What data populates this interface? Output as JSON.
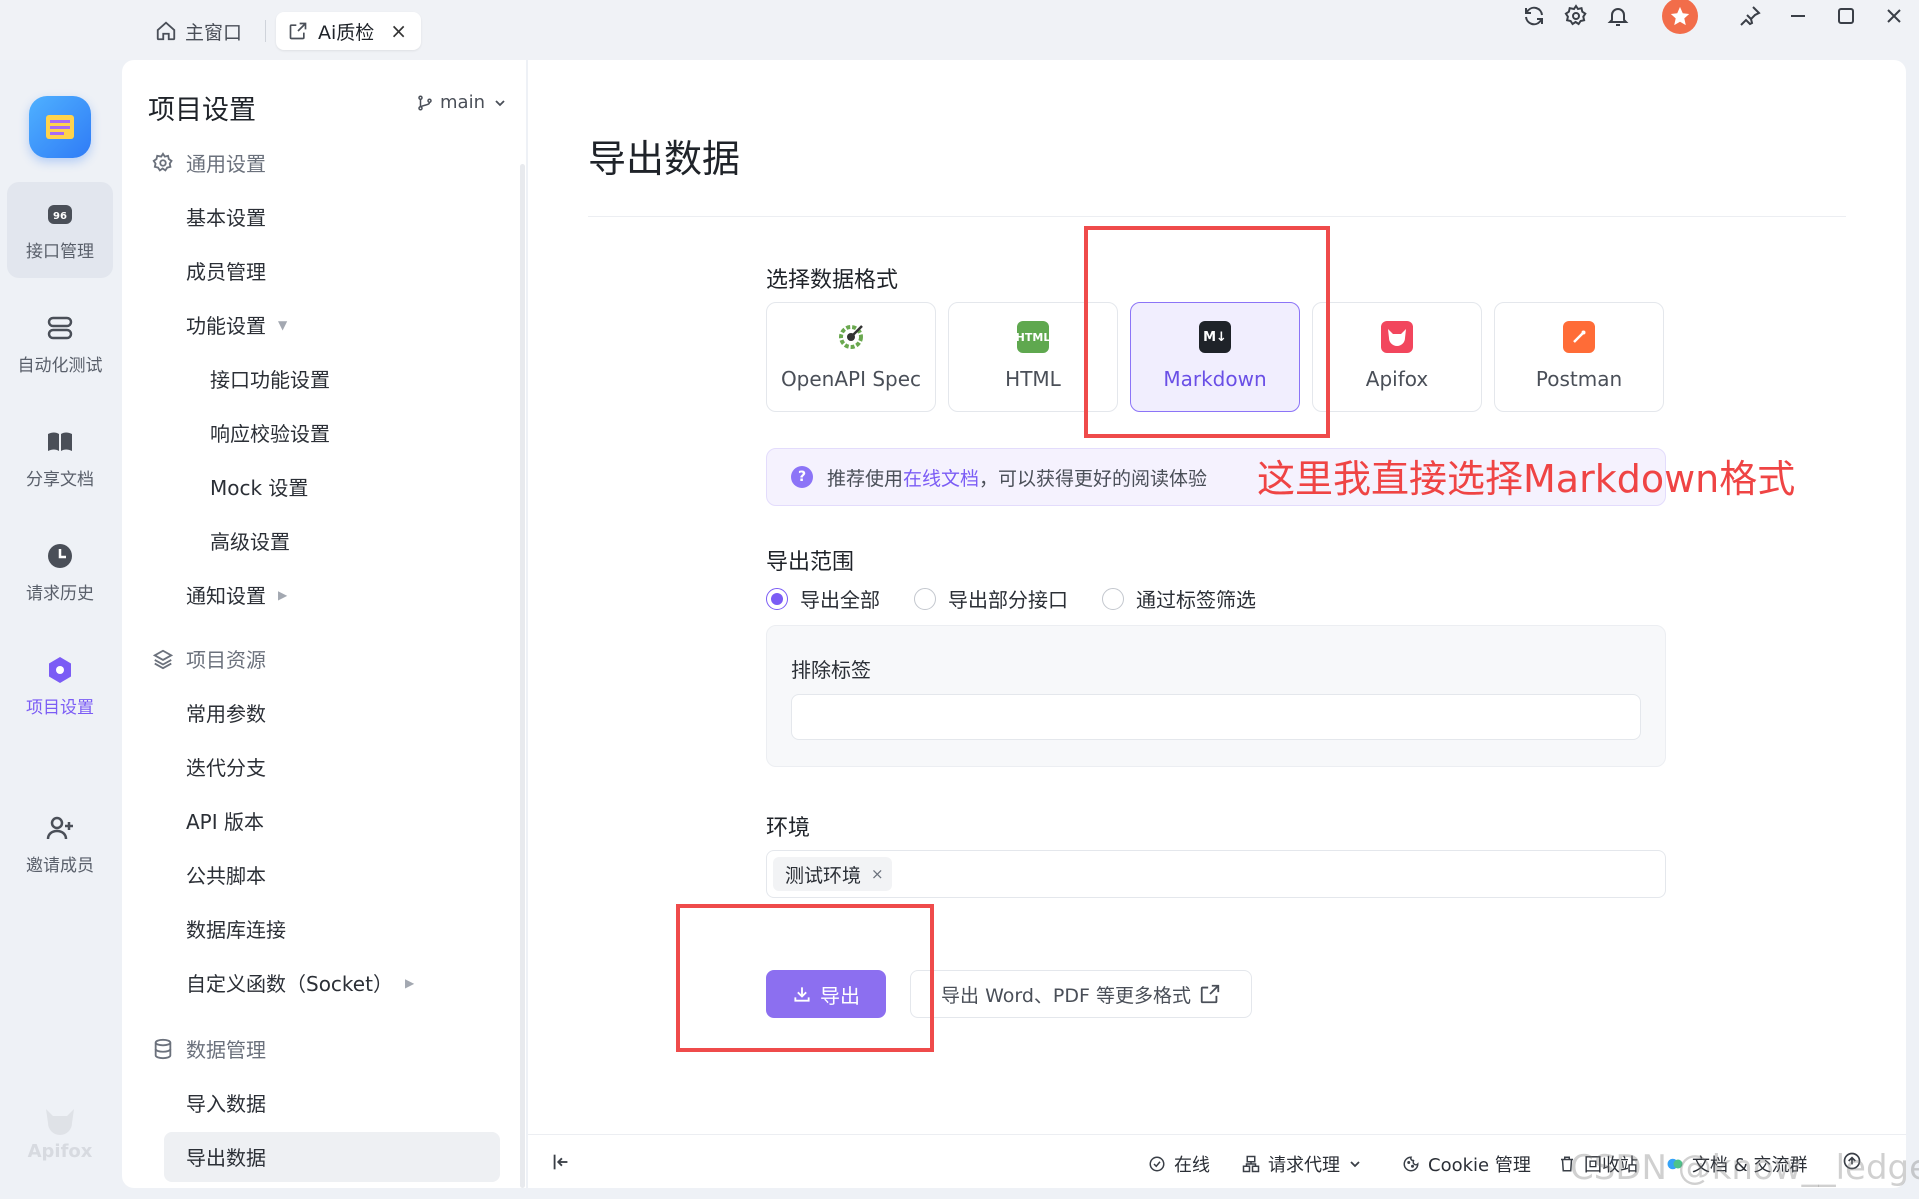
{
  "titlebar": {
    "home_tab": "主窗口",
    "active_tab": "Ai质检",
    "close_glyph": "×",
    "icons": [
      "refresh-icon",
      "settings-icon",
      "bell-icon",
      "avatar",
      "pin-icon",
      "minimize-icon",
      "maximize-icon",
      "close-icon"
    ]
  },
  "rail": {
    "items": [
      {
        "label": "接口管理",
        "icon": "api-icon"
      },
      {
        "label": "自动化测试",
        "icon": "automation-icon"
      },
      {
        "label": "分享文档",
        "icon": "book-icon"
      },
      {
        "label": "请求历史",
        "icon": "clock-icon"
      },
      {
        "label": "项目设置",
        "icon": "hexagon-icon"
      },
      {
        "label": "邀请成员",
        "icon": "add-user-icon"
      }
    ],
    "brand": "Apifox"
  },
  "sidebar": {
    "title": "项目设置",
    "branch": "main",
    "general": {
      "label": "通用设置",
      "items": [
        "基本设置",
        "成员管理",
        "功能设置",
        "接口功能设置",
        "响应校验设置",
        "Mock 设置",
        "高级设置",
        "通知设置"
      ]
    },
    "resources": {
      "label": "项目资源",
      "items": [
        "常用参数",
        "迭代分支",
        "API 版本",
        "公共脚本",
        "数据库连接",
        "自定义函数（Socket）"
      ]
    },
    "data": {
      "label": "数据管理",
      "items": [
        "导入数据",
        "导出数据"
      ]
    }
  },
  "main": {
    "title": "导出数据",
    "format_label": "选择数据格式",
    "formats": [
      {
        "label": "OpenAPI Spec",
        "icon": "openapi-icon"
      },
      {
        "label": "HTML",
        "icon": "html-icon",
        "badge": "HTML"
      },
      {
        "label": "Markdown",
        "icon": "markdown-icon",
        "badge": "M↓"
      },
      {
        "label": "Apifox",
        "icon": "apifox-icon"
      },
      {
        "label": "Postman",
        "icon": "postman-icon"
      }
    ],
    "selected_format": "Markdown",
    "tip": {
      "before": "推荐使用",
      "link": "在线文档",
      "after": "，可以获得更好的阅读体验"
    },
    "scope_label": "导出范围",
    "scope_options": [
      "导出全部",
      "导出部分接口",
      "通过标签筛选"
    ],
    "scope_selected": "导出全部",
    "exclude_label": "排除标签",
    "exclude_value": "",
    "env_label": "环境",
    "env_tag": "测试环境",
    "env_tag_close": "×",
    "export_button": "导出",
    "more_button": "导出 Word、PDF 等更多格式"
  },
  "statusbar": {
    "online": "在线",
    "proxy": "请求代理",
    "cookie": "Cookie 管理",
    "recycle": "回收站",
    "docs": "文档 & 交流群"
  },
  "annotation": {
    "text": "这里我直接选择Markdown格式",
    "color": "#ef4444"
  },
  "watermark": "CSDN @know__ledge",
  "colors": {
    "accent": "#7b5cf5",
    "annotation_red": "#ef4b4b"
  }
}
